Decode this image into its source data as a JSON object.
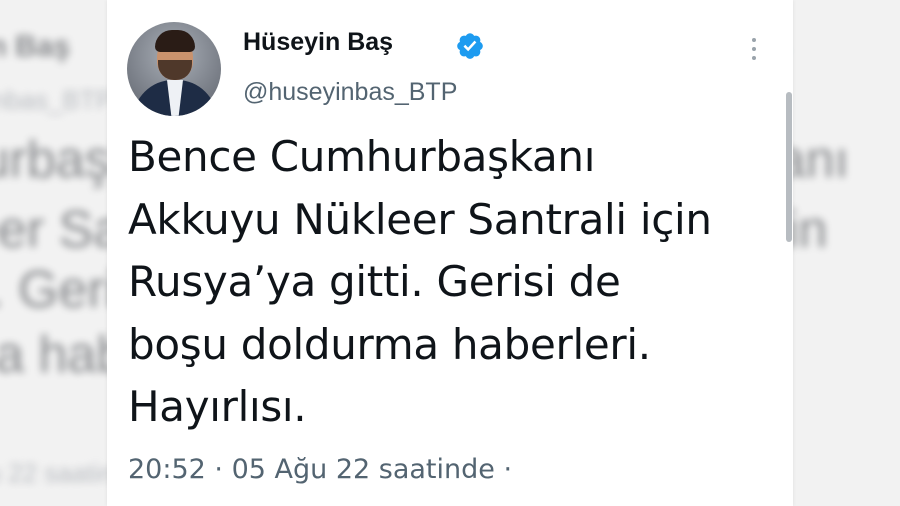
{
  "tweet": {
    "author_name": "Hüseyin Baş",
    "handle": "@huseyinbas_BTP",
    "lines": [
      "Bence Cumhurbaşkanı",
      "Akkuyu Nükleer Santrali için",
      "Rusya’ya gitti. Gerisi de",
      "boşu doldurma haberleri.",
      "Hayırlısı."
    ],
    "time": "20:52",
    "date": "05 Ağu 22 saatinde",
    "separator": "·"
  },
  "icons": {
    "verified": "verified-badge-icon",
    "more": "more-options-icon"
  },
  "colors": {
    "verified_blue": "#1d9bf0",
    "text_primary": "#0f1419",
    "text_secondary": "#536471"
  }
}
